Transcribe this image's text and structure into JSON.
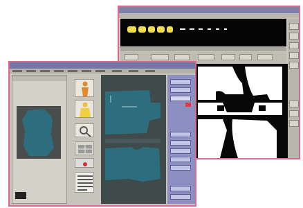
{
  "colors": {
    "window_border": "#d96a8e",
    "titlebar_back": "#7b83a8",
    "titlebar_front": "#6f78a6",
    "fabric_teal": "#2c6d7e",
    "thumbnail_yellow": "#f2e04a",
    "right_panel": "#8d8fc2",
    "cutting_canvas": "#070707"
  },
  "back_window": {
    "title": "",
    "toolbar_labels": [
      "",
      "",
      "",
      ""
    ]
  },
  "front_window": {
    "title": ""
  },
  "icons": {
    "back_right_buttons": [
      "tool-icon",
      "tool-icon",
      "tool-icon",
      "tool-icon"
    ],
    "front_left_column": [
      "figure-orange-icon",
      "figure-yellow-icon",
      "magnifier-icon",
      "grid-icon"
    ]
  }
}
